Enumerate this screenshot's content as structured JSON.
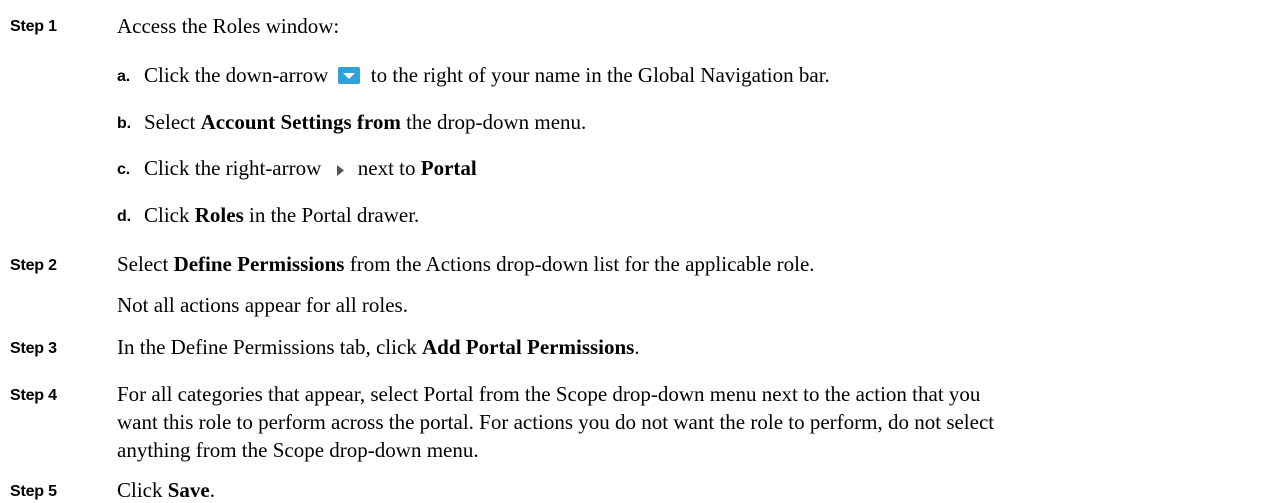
{
  "steps": [
    {
      "label": "Step 1",
      "text": "Access the Roles window:"
    },
    {
      "label": "Step 2",
      "pre": "Select ",
      "bold": "Define Permissions",
      "post": " from the Actions drop-down list for the applicable role."
    },
    {
      "label": "Step 3",
      "pre": "In the Define Permissions tab, click ",
      "bold": "Add Portal Permissions",
      "post": "."
    },
    {
      "label": "Step 4",
      "line1": "For all categories that appear, select Portal from the Scope drop-down menu next to the action that you",
      "line2": "want this role to perform across the portal. For actions you do not want the role to perform, do not select",
      "line3": "anything from the Scope drop-down menu."
    },
    {
      "label": "Step 5",
      "pre": "Click ",
      "bold": "Save",
      "post": "."
    }
  ],
  "substeps": [
    {
      "label": "a.",
      "pre": "Click the down-arrow",
      "post": "to the right of your name in the Global Navigation bar.",
      "icon": "down-arrow-icon"
    },
    {
      "label": "b.",
      "pre": "Select ",
      "bold": "Account Settings from",
      "post": " the drop-down menu."
    },
    {
      "label": "c.",
      "pre": "Click the right-arrow",
      "post": "next to ",
      "bold": "Portal",
      "icon": "right-arrow-icon"
    },
    {
      "label": "d.",
      "pre": "Click ",
      "bold": "Roles",
      "post": " in the Portal drawer."
    }
  ],
  "step2_note": "Not all actions appear for all roles.",
  "colors": {
    "down_arrow_bg": "#2ea1dc",
    "right_arrow": "#555555"
  }
}
